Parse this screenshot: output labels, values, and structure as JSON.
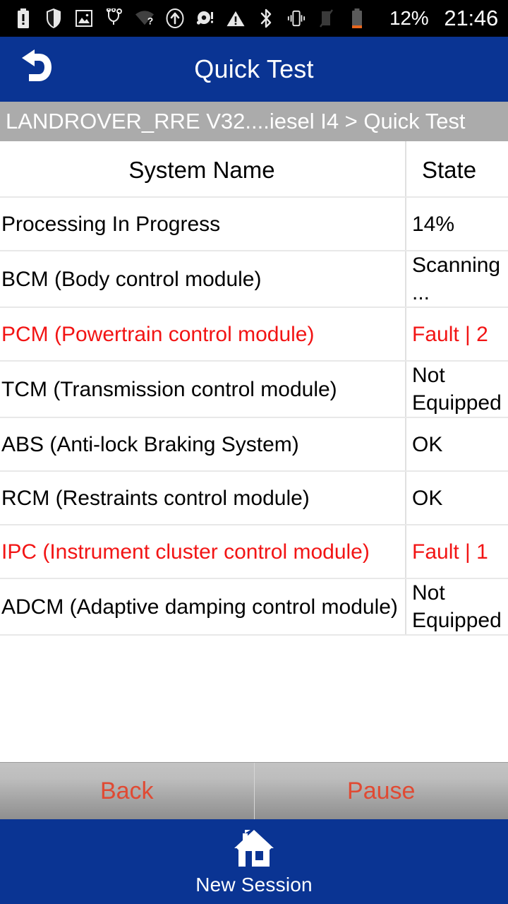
{
  "status_bar": {
    "icons": [
      {
        "name": "battery-alert-icon"
      },
      {
        "name": "shield-icon"
      },
      {
        "name": "image-icon"
      },
      {
        "name": "stethoscope-icon"
      },
      {
        "name": "wifi-unknown-icon"
      },
      {
        "name": "upload-circle-icon"
      },
      {
        "name": "disc-alert-icon"
      },
      {
        "name": "warning-triangle-icon"
      },
      {
        "name": "bluetooth-icon"
      },
      {
        "name": "vibrate-icon"
      },
      {
        "name": "signal-off-icon"
      },
      {
        "name": "battery-low-icon"
      }
    ],
    "battery_percent": "12%",
    "clock": "21:46"
  },
  "header": {
    "back_icon": "back-arrow-icon",
    "title": "Quick Test"
  },
  "breadcrumb": {
    "text": "LANDROVER_RRE V32....iesel I4 > Quick Test"
  },
  "table": {
    "columns": [
      "System Name",
      "State"
    ],
    "rows": [
      {
        "name": "Processing In Progress",
        "state": "14%",
        "fault": false
      },
      {
        "name": "BCM (Body control module)",
        "state": "Scanning...",
        "fault": false
      },
      {
        "name": "PCM (Powertrain control module)",
        "state": "Fault | 2",
        "fault": true
      },
      {
        "name": "TCM (Transmission control module)",
        "state": "Not Equipped",
        "fault": false
      },
      {
        "name": "ABS (Anti-lock Braking System)",
        "state": "OK",
        "fault": false
      },
      {
        "name": "RCM (Restraints control module)",
        "state": "OK",
        "fault": false
      },
      {
        "name": "IPC (Instrument cluster control module)",
        "state": "Fault | 1",
        "fault": true
      },
      {
        "name": "ADCM (Adaptive damping control module)",
        "state": "Not Equipped",
        "fault": false
      }
    ]
  },
  "actions": {
    "back_label": "Back",
    "pause_label": "Pause"
  },
  "bottom_nav": {
    "home_icon": "home-icon",
    "home_label": "New Session"
  },
  "colors": {
    "brand_blue": "#0a3493",
    "breadcrumb_gray": "#ababab",
    "fault_red": "#f21414",
    "button_text_red": "#e04a33",
    "status_bar_black": "#000000"
  }
}
